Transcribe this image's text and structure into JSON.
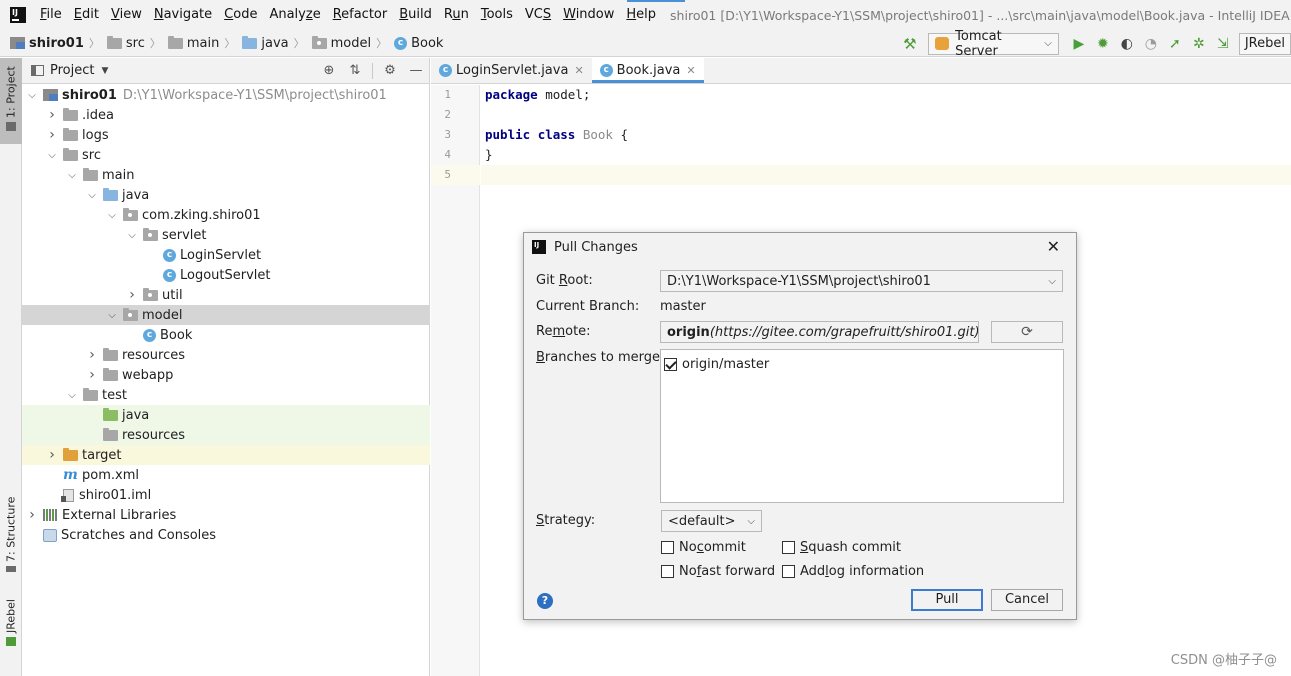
{
  "menubar": {
    "items": [
      {
        "mn": "F",
        "rest": "ile"
      },
      {
        "mn": "E",
        "rest": "dit"
      },
      {
        "mn": "V",
        "rest": "iew"
      },
      {
        "mn": "N",
        "rest": "avigate"
      },
      {
        "mn": "C",
        "rest": "ode"
      },
      {
        "pre": "Analy",
        "mn": "z",
        "rest": "e"
      },
      {
        "mn": "R",
        "rest": "efactor"
      },
      {
        "mn": "B",
        "rest": "uild"
      },
      {
        "pre": "R",
        "mn": "u",
        "rest": "n"
      },
      {
        "mn": "T",
        "rest": "ools"
      },
      {
        "pre": "VC",
        "mn": "S",
        "rest": ""
      },
      {
        "mn": "W",
        "rest": "indow"
      },
      {
        "mn": "H",
        "rest": "elp"
      }
    ],
    "title": "shiro01 [D:\\Y1\\Workspace-Y1\\SSM\\project\\shiro01] - ...\\src\\main\\java\\model\\Book.java - IntelliJ IDEA"
  },
  "breadcrumbs": [
    "shiro01",
    "src",
    "main",
    "java",
    "model",
    "Book"
  ],
  "toolbar": {
    "run_config": "Tomcat Server",
    "jrebel": "JRebel"
  },
  "sidebar": {
    "project_tab": "1: Project",
    "structure_tab": "7: Structure",
    "jrebel_tab": "JRebel"
  },
  "project": {
    "title": "Project",
    "tree": [
      {
        "label": "shiro01",
        "path": "D:\\Y1\\Workspace-Y1\\SSM\\project\\shiro01",
        "depth": 0,
        "arrow": "down",
        "icon": "module",
        "bold": true
      },
      {
        "label": ".idea",
        "depth": 1,
        "arrow": "right",
        "icon": "folder"
      },
      {
        "label": "logs",
        "depth": 1,
        "arrow": "right",
        "icon": "folder"
      },
      {
        "label": "src",
        "depth": 1,
        "arrow": "down",
        "icon": "folder"
      },
      {
        "label": "main",
        "depth": 2,
        "arrow": "down",
        "icon": "folder"
      },
      {
        "label": "java",
        "depth": 3,
        "arrow": "down",
        "icon": "folder-blue"
      },
      {
        "label": "com.zking.shiro01",
        "depth": 4,
        "arrow": "down",
        "icon": "package"
      },
      {
        "label": "servlet",
        "depth": 5,
        "arrow": "down",
        "icon": "package"
      },
      {
        "label": "LoginServlet",
        "depth": 6,
        "arrow": "none",
        "icon": "class"
      },
      {
        "label": "LogoutServlet",
        "depth": 6,
        "arrow": "none",
        "icon": "class"
      },
      {
        "label": "util",
        "depth": 5,
        "arrow": "right",
        "icon": "package"
      },
      {
        "label": "model",
        "depth": 4,
        "arrow": "down",
        "icon": "package",
        "selected": true
      },
      {
        "label": "Book",
        "depth": 5,
        "arrow": "none",
        "icon": "class"
      },
      {
        "label": "resources",
        "depth": 3,
        "arrow": "right",
        "icon": "folder"
      },
      {
        "label": "webapp",
        "depth": 3,
        "arrow": "right",
        "icon": "folder"
      },
      {
        "label": "test",
        "depth": 2,
        "arrow": "down",
        "icon": "folder"
      },
      {
        "label": "java",
        "depth": 3,
        "arrow": "none",
        "icon": "folder-green",
        "bg": "green"
      },
      {
        "label": "resources",
        "depth": 3,
        "arrow": "none",
        "icon": "folder-res",
        "bg": "green"
      },
      {
        "label": "target",
        "depth": 1,
        "arrow": "right",
        "icon": "folder-orange",
        "bg": "yellow"
      },
      {
        "label": "pom.xml",
        "depth": 1,
        "arrow": "none",
        "icon": "xml"
      },
      {
        "label": "shiro01.iml",
        "depth": 1,
        "arrow": "none",
        "icon": "file"
      },
      {
        "label": "External Libraries",
        "depth": 0,
        "arrow": "right",
        "icon": "lib"
      },
      {
        "label": "Scratches and Consoles",
        "depth": 0,
        "arrow": "none",
        "icon": "scratch"
      }
    ]
  },
  "editor": {
    "tabs": [
      {
        "label": "LoginServlet.java",
        "active": false
      },
      {
        "label": "Book.java",
        "active": true
      }
    ],
    "lines": [
      [
        {
          "t": "package",
          "c": "kw"
        },
        {
          "t": " model;",
          "c": ""
        }
      ],
      [],
      [
        {
          "t": "public",
          "c": "kw"
        },
        {
          "t": " ",
          "c": ""
        },
        {
          "t": "class",
          "c": "kw"
        },
        {
          "t": " ",
          "c": ""
        },
        {
          "t": "Book",
          "c": "cls"
        },
        {
          "t": " {",
          "c": ""
        }
      ],
      [
        {
          "t": "}",
          "c": ""
        }
      ],
      []
    ],
    "line_numbers": [
      "1",
      "2",
      "3",
      "4",
      "5"
    ],
    "current_line": 5
  },
  "dialog": {
    "title": "Pull Changes",
    "git_root_label": {
      "pre": "Git ",
      "mn": "R",
      "rest": "oot:"
    },
    "git_root_value": "D:\\Y1\\Workspace-Y1\\SSM\\project\\shiro01",
    "current_branch_label": "Current Branch:",
    "current_branch_value": "master",
    "remote_label": {
      "pre": "Re",
      "mn": "m",
      "rest": "ote:"
    },
    "remote_name": "origin",
    "remote_url": "(https://gitee.com/grapefruitt/shiro01.git)",
    "branches_label": {
      "pre": "",
      "mn": "B",
      "rest": "ranches to merge:"
    },
    "branches": [
      {
        "label": "origin/master",
        "checked": true
      }
    ],
    "strategy_label": {
      "pre": "",
      "mn": "S",
      "rest": "trategy:"
    },
    "strategy_value": "<default>",
    "options": [
      {
        "pre": "No ",
        "mn": "c",
        "rest": "ommit",
        "checked": false
      },
      {
        "pre": "",
        "mn": "S",
        "rest": "quash commit",
        "checked": false
      },
      {
        "pre": "No ",
        "mn": "f",
        "rest": "ast forward",
        "checked": false
      },
      {
        "pre": "Add ",
        "mn": "l",
        "rest": "og information",
        "checked": false
      }
    ],
    "pull_label": "Pull",
    "cancel_label": "Cancel",
    "help": "?"
  },
  "watermark": "CSDN @柚子子@"
}
